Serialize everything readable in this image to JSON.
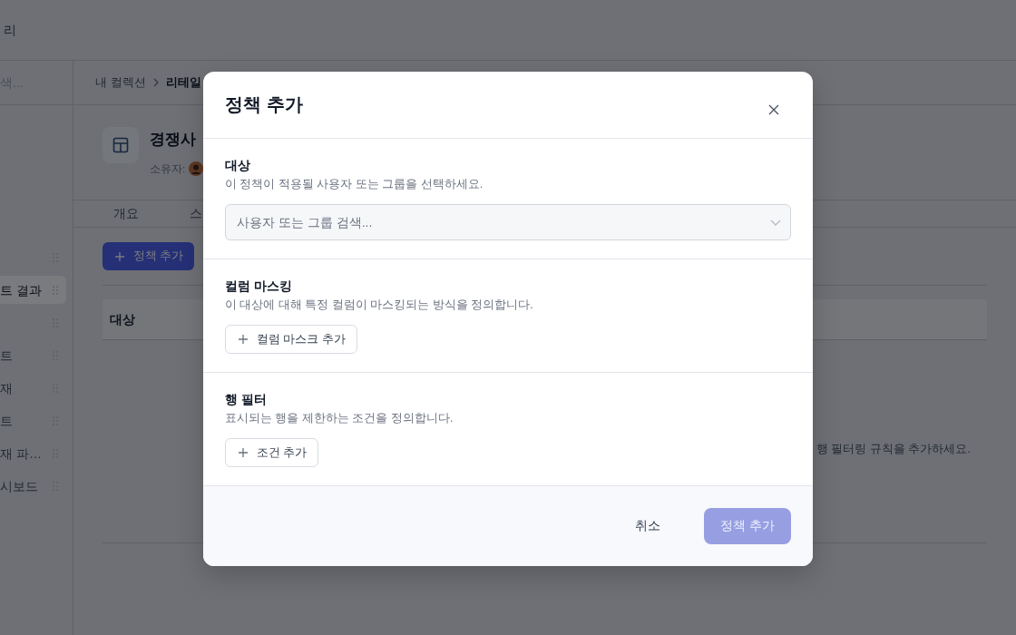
{
  "app_header": {
    "title": "리"
  },
  "sidebar": {
    "search": {
      "placeholder": "색..."
    },
    "items": [
      {
        "selected": false
      },
      {
        "label": "트 결과",
        "selected": true
      },
      {
        "selected": false
      },
      {
        "label": "트",
        "selected": false
      },
      {
        "label": "재",
        "selected": false
      },
      {
        "label": "트",
        "selected": false
      },
      {
        "label": "재 파…",
        "selected": false
      },
      {
        "label": "시보드",
        "selected": false
      }
    ]
  },
  "breadcrumb": [
    {
      "label": "내 컬렉션",
      "current": false
    },
    {
      "label": "리테일",
      "current": true
    }
  ],
  "page_header": {
    "title": "경쟁사",
    "owner_label": "소유자:"
  },
  "tabs": [
    {
      "label": "개요",
      "selected": false
    },
    {
      "label": "스",
      "selected": false
    }
  ],
  "add_policy_button": {
    "label": "정책 추가"
  },
  "table": {
    "columns": [
      "대상"
    ],
    "empty_text": "행 필터링 규칙을 추가하세요."
  },
  "modal": {
    "title": "정책 추가",
    "sections": [
      {
        "kind": "select",
        "label": "대상",
        "description": "이 정책이 적용될 사용자 또는 그룹을 선택하세요.",
        "placeholder": "사용자 또는 그룹 검색..."
      },
      {
        "kind": "add",
        "label": "컬럼 마스킹",
        "description": "이 대상에 대해 특정 컬럼이 마스킹되는 방식을 정의합니다.",
        "button": "컬럼 마스크 추가"
      },
      {
        "kind": "add",
        "label": "행 필터",
        "description": "표시되는 행을 제한하는 조건을 정의합니다.",
        "button": "조건 추가"
      }
    ],
    "footer": {
      "cancel": "취소",
      "submit": {
        "label": "정책 추가",
        "disabled": true
      }
    }
  }
}
